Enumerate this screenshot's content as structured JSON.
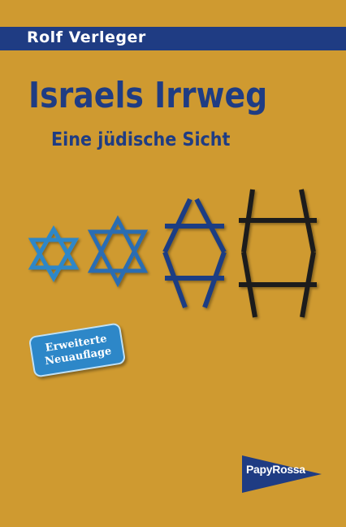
{
  "cover": {
    "author": "Rolf Verleger",
    "title": "Israels Irrweg",
    "subtitle": "Eine jüdische Sicht",
    "badge": {
      "line1": "Erweiterte",
      "line2": "Neuauflage"
    },
    "publisher": "PapyRossa"
  },
  "colors": {
    "background": "#cf9a30",
    "dark_blue": "#1f3c83",
    "light_blue": "#2d87c8",
    "medium_blue": "#2b6db3",
    "star_black": "#1c1c1c"
  },
  "illustration": {
    "shapes": [
      "star-of-david-light-blue-icon",
      "star-of-david-medium-blue-icon",
      "stretched-star-dark-blue-icon",
      "rectangular-frame-black-icon"
    ]
  }
}
